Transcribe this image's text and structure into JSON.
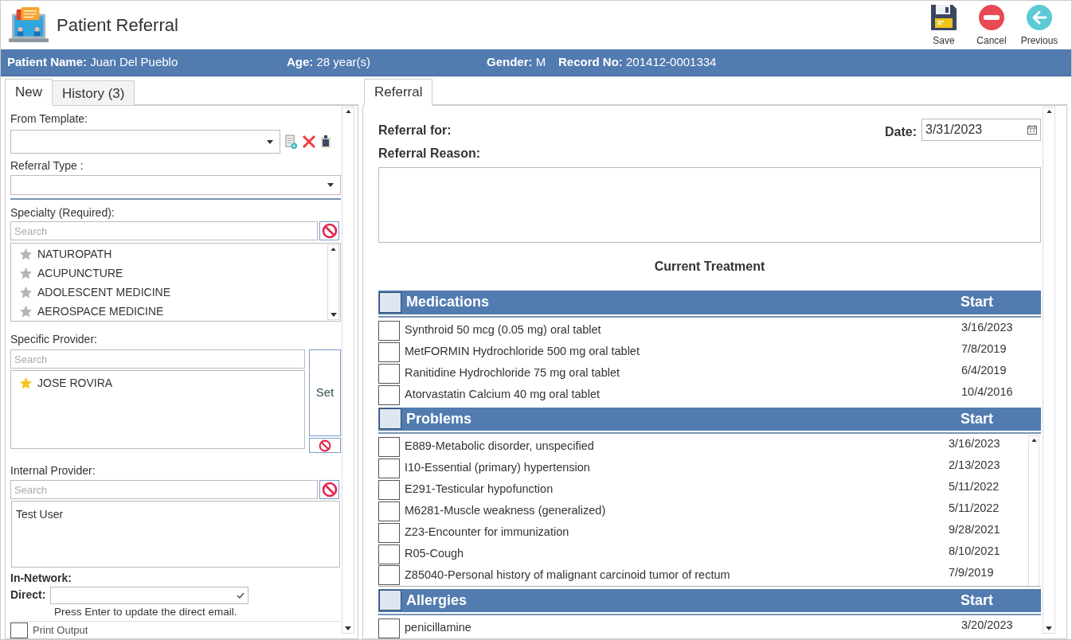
{
  "window": {
    "title": "Patient Referral"
  },
  "toolbar": [
    {
      "kind": "save",
      "label": "Save"
    },
    {
      "kind": "cancel",
      "label": "Cancel"
    },
    {
      "kind": "previous",
      "label": "Previous"
    }
  ],
  "patient_bar": [
    {
      "label": "Patient Name:",
      "value": "Juan Del Pueblo"
    },
    {
      "label": "Age:",
      "value": "28 year(s)"
    },
    {
      "label": "Gender:",
      "value": "M"
    },
    {
      "label": "Record No:",
      "value": "201412-0001334"
    }
  ],
  "left_tabs": [
    {
      "label": "New",
      "selected": true
    },
    {
      "label": "History",
      "count": "(3)",
      "selected": false
    }
  ],
  "from_template": {
    "label": "From Template:"
  },
  "referral_type": {
    "label": "Referral Type :"
  },
  "specialty": {
    "label": "Specialty (Required):",
    "placeholder": "Search",
    "items": [
      {
        "name": "NATUROPATH",
        "favorite": false
      },
      {
        "name": "ACUPUNCTURE",
        "favorite": false
      },
      {
        "name": "ADOLESCENT MEDICINE",
        "favorite": false
      },
      {
        "name": "AEROSPACE MEDICINE",
        "favorite": false
      }
    ]
  },
  "specific_provider": {
    "label": "Specific Provider:",
    "placeholder": "Search",
    "set_button": "Set",
    "items": [
      {
        "name": "JOSE ROVIRA",
        "favorite": true
      }
    ]
  },
  "internal_provider": {
    "label": "Internal Provider:",
    "placeholder": "Search",
    "items": [
      "Test User"
    ]
  },
  "in_network": {
    "label": "In-Network:"
  },
  "direct": {
    "label": "Direct:",
    "hint": "Press Enter to update the direct email."
  },
  "print_output": {
    "label": "Print Output",
    "checked": false
  },
  "right_tabs": [
    {
      "label": "Referral",
      "selected": true
    }
  ],
  "referral": {
    "for_label": "Referral for:",
    "reason_label": "Referral Reason:",
    "date_label": "Date:",
    "date": "3/31/2023",
    "current_treatment": "Current Treatment"
  },
  "sections": [
    {
      "title": "Medications",
      "column": "Start",
      "checked": false,
      "scroll": false,
      "rows": [
        {
          "name": "Synthroid 50 mcg (0.05 mg) oral tablet",
          "start": "3/16/2023",
          "checked": false
        },
        {
          "name": "MetFORMIN Hydrochloride 500 mg oral tablet",
          "start": "7/8/2019",
          "checked": false
        },
        {
          "name": "Ranitidine Hydrochloride 75 mg oral tablet",
          "start": "6/4/2019",
          "checked": false
        },
        {
          "name": "Atorvastatin Calcium 40 mg oral tablet",
          "start": "10/4/2016",
          "checked": false
        }
      ]
    },
    {
      "title": "Problems",
      "column": "Start",
      "checked": false,
      "scroll": true,
      "rows": [
        {
          "name": "E889-Metabolic disorder, unspecified",
          "start": "3/16/2023",
          "checked": false
        },
        {
          "name": "I10-Essential (primary) hypertension",
          "start": "2/13/2023",
          "checked": false
        },
        {
          "name": "E291-Testicular hypofunction",
          "start": "5/11/2022",
          "checked": false
        },
        {
          "name": "M6281-Muscle weakness (generalized)",
          "start": "5/11/2022",
          "checked": false
        },
        {
          "name": "Z23-Encounter for immunization",
          "start": "9/28/2021",
          "checked": false
        },
        {
          "name": "R05-Cough",
          "start": "8/10/2021",
          "checked": false
        },
        {
          "name": "Z85040-Personal history of malignant carcinoid tumor of rectum",
          "start": "7/9/2019",
          "checked": false
        }
      ]
    },
    {
      "title": "Allergies",
      "column": "Start",
      "checked": false,
      "scroll": false,
      "rows": [
        {
          "name": "penicillamine",
          "start": "3/20/2023",
          "checked": false
        }
      ]
    }
  ]
}
